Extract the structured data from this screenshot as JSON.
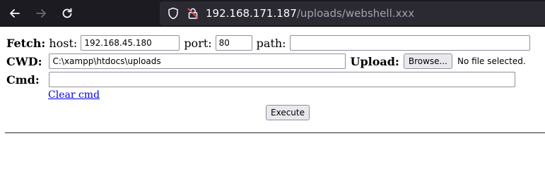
{
  "browser": {
    "url_host": "192.168.171.187",
    "url_path": "/uploads/webshell.xxx"
  },
  "form": {
    "fetch": {
      "label": "Fetch:",
      "host_label": "host:",
      "host_value": "192.168.45.180",
      "port_label": "port:",
      "port_value": "80",
      "path_label": "path:",
      "path_value": ""
    },
    "cwd": {
      "label": "CWD:",
      "value": "C:\\xampp\\htdocs\\uploads"
    },
    "upload": {
      "label": "Upload:",
      "browse_label": "Browse...",
      "status": "No file selected."
    },
    "cmd": {
      "label": "Cmd:",
      "value": "",
      "clear_link": "Clear cmd",
      "execute_label": "Execute"
    }
  }
}
